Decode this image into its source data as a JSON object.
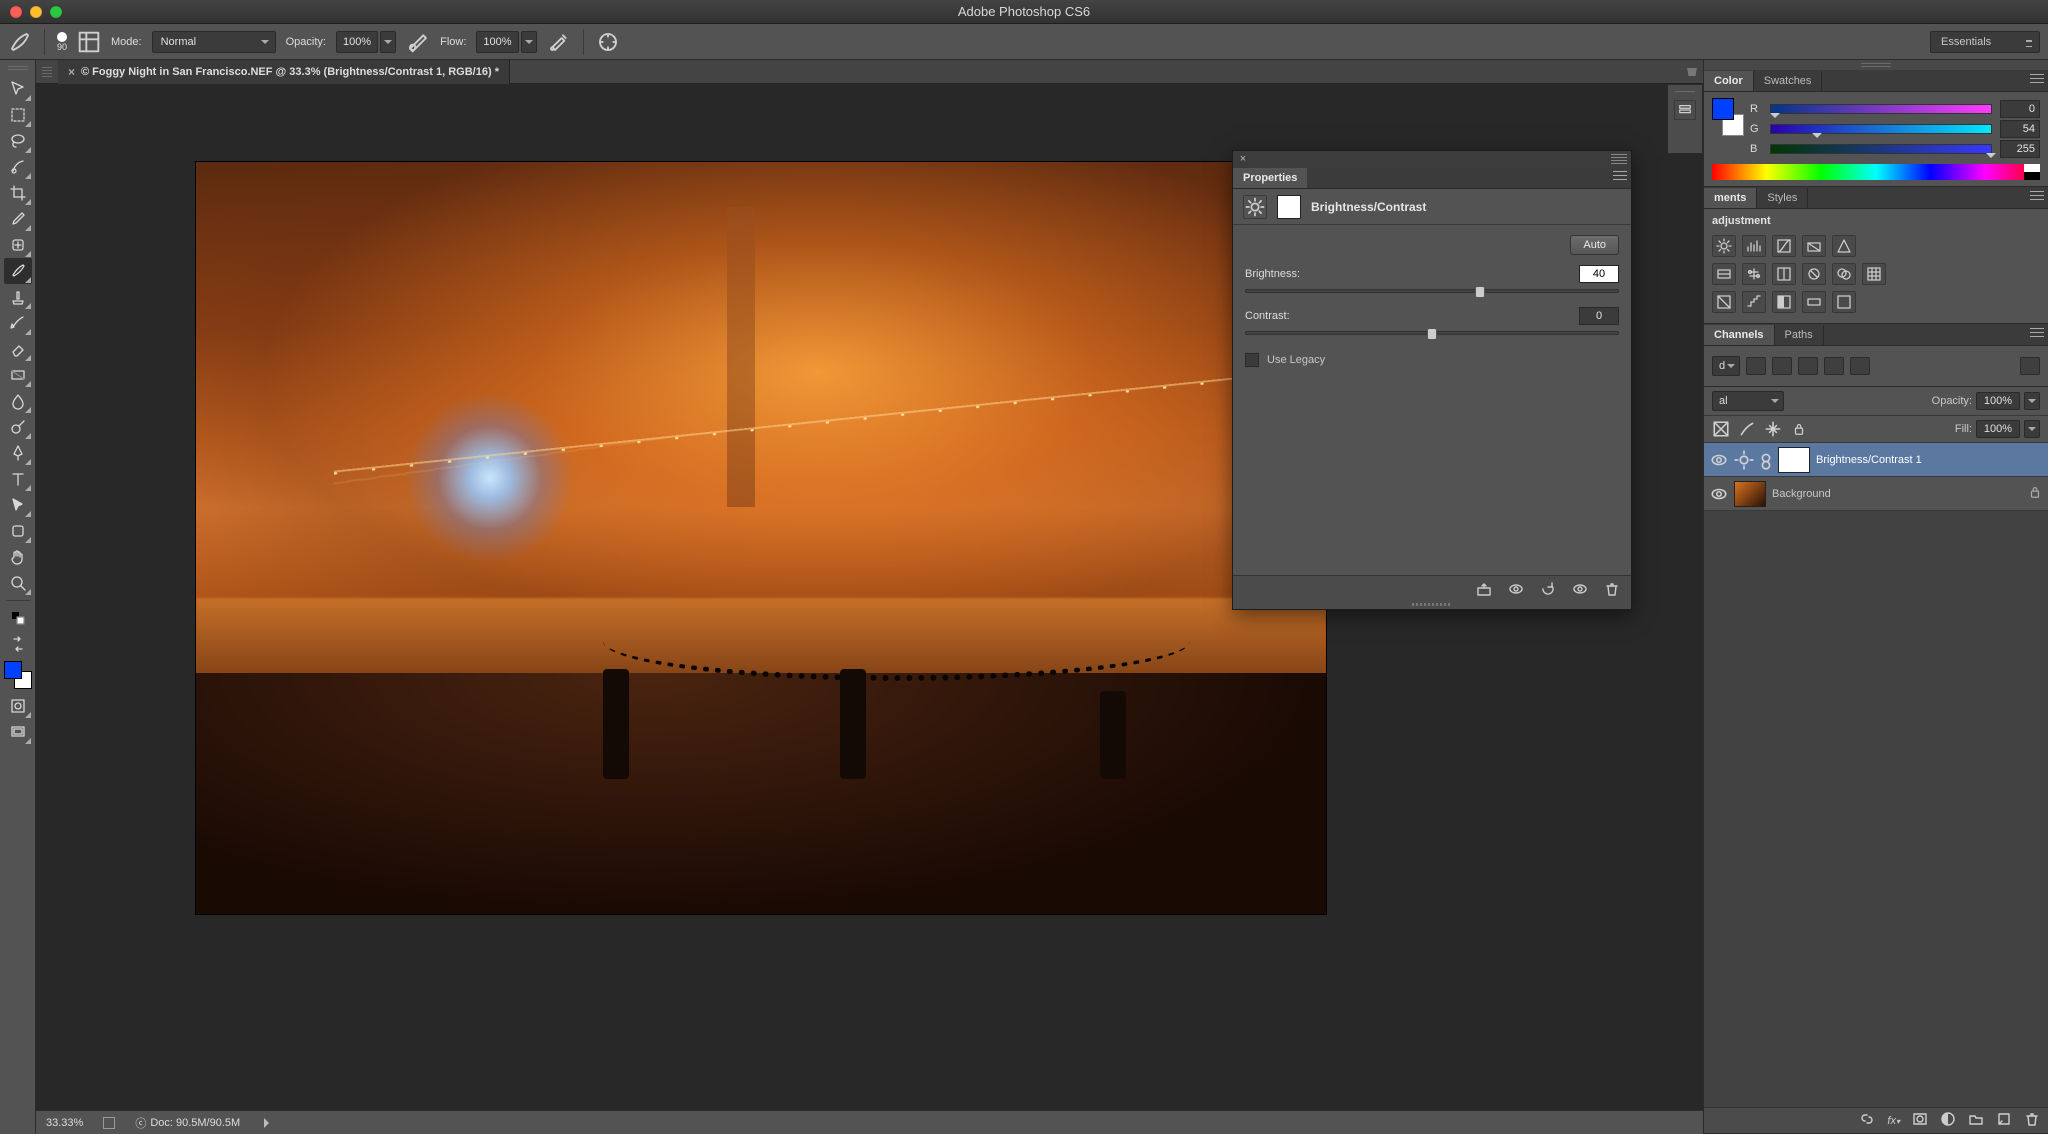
{
  "app": {
    "title": "Adobe Photoshop CS6"
  },
  "workspace": {
    "selected": "Essentials"
  },
  "options": {
    "brush_size": "90",
    "mode_label": "Mode:",
    "mode_value": "Normal",
    "opacity_label": "Opacity:",
    "opacity_value": "100%",
    "flow_label": "Flow:",
    "flow_value": "100%"
  },
  "document": {
    "tab_title": "© Foggy Night in San Francisco.NEF @ 33.3% (Brightness/Contrast 1, RGB/16) *"
  },
  "status": {
    "zoom": "33.33%",
    "doc_info": "Doc: 90.5M/90.5M"
  },
  "color": {
    "tab_color": "Color",
    "tab_swatches": "Swatches",
    "r_label": "R",
    "r_value": "0",
    "g_label": "G",
    "g_value": "54",
    "b_label": "B",
    "b_value": "255",
    "fg_hex": "#0036ff"
  },
  "adjustments": {
    "tab_label": "ments",
    "tab_styles": "Styles",
    "title": "adjustment"
  },
  "channels": {
    "tab_channels": "Channels",
    "tab_paths": "Paths",
    "blend_trunc": "d",
    "mode_trunc": "al"
  },
  "layers": {
    "opacity_label": "Opacity:",
    "opacity_value": "100%",
    "fill_label": "Fill:",
    "fill_value": "100%",
    "items": [
      {
        "name": "Brightness/Contrast 1"
      },
      {
        "name": "Background"
      }
    ]
  },
  "properties": {
    "panel_title": "Properties",
    "adj_name": "Brightness/Contrast",
    "auto": "Auto",
    "brightness_label": "Brightness:",
    "brightness_value": "40",
    "contrast_label": "Contrast:",
    "contrast_value": "0",
    "legacy_label": "Use Legacy"
  }
}
